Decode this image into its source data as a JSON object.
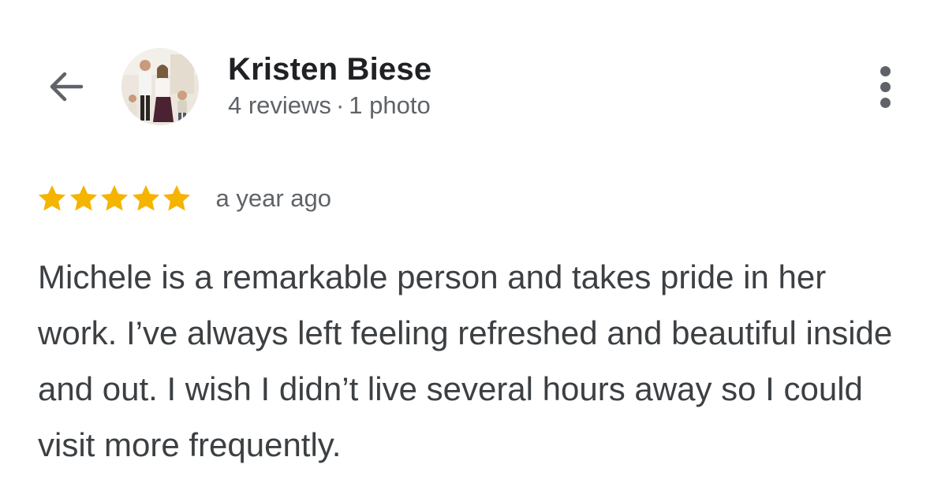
{
  "header": {
    "back_icon": "arrow-left-icon",
    "avatar_icon": "profile-photo",
    "reviewer_name": "Kristen Biese",
    "review_count": "4 reviews",
    "separator": "·",
    "photo_count": "1 photo",
    "more_icon": "more-vertical-icon"
  },
  "review": {
    "rating": 5,
    "rating_max": 5,
    "star_icon": "star-icon",
    "date": "a year ago",
    "text": "Michele is a remarkable person and takes pride in her work. I’ve always left feeling refreshed and beautiful inside and out. I wish I didn’t live several hours away so I could visit more frequently."
  },
  "colors": {
    "star": "#F4B400",
    "name": "#202124",
    "secondary_text": "#5F6368",
    "body_text": "#3C4043",
    "icon": "#5F6368"
  }
}
